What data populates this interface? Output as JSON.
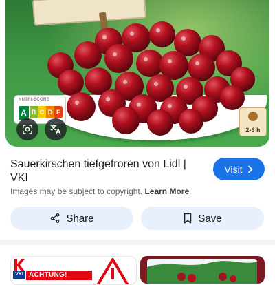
{
  "result": {
    "title": "Sauerkirschen tiefgefroren von Lidl | VKI",
    "visit_label": "Visit",
    "copyright_notice": "Images may be subject to copyright.",
    "learn_more_label": "Learn More"
  },
  "preview": {
    "nutriscore_title": "NUTRI-SCORE",
    "nutriscore_grades": [
      "A",
      "B",
      "C",
      "D",
      "E"
    ],
    "nutriscore_active": "A",
    "thaw_time": "2-3 h"
  },
  "actions": {
    "share_label": "Share",
    "save_label": "Save"
  },
  "related": {
    "left_brand": "VKI",
    "left_banner": "ACHTUNG!"
  },
  "colors": {
    "accent": "#1a73e8",
    "button_bg": "#e8f0fe",
    "nutri_a": "#038141",
    "nutri_b": "#85bb2f",
    "nutri_c": "#fecb02",
    "nutri_d": "#ee8100",
    "nutri_e": "#e63e11"
  },
  "icons": {
    "lens": "lens-icon",
    "translate": "translate-icon",
    "visit": "chevron-right-icon",
    "share": "share-icon",
    "save": "bookmark-icon"
  }
}
